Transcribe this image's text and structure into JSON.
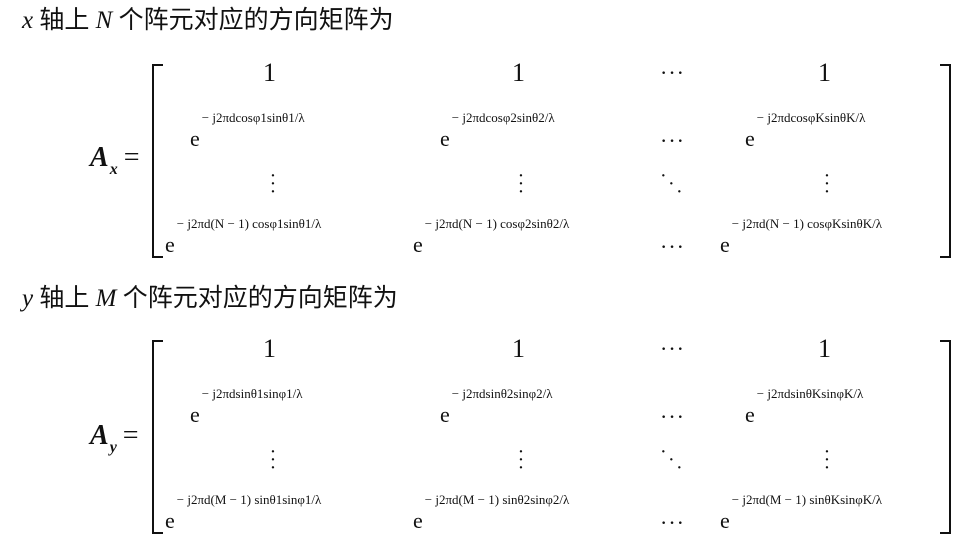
{
  "section_x": {
    "heading": {
      "axis": "x",
      "text1": " 轴上 ",
      "count": "N",
      "text2": " 个阵元对应的方向矩阵为"
    },
    "lhs": {
      "symbol": "A",
      "sub": "x",
      "eq": "="
    },
    "row1": {
      "c1": "1",
      "c2": "1",
      "c3": "···",
      "c4": "1"
    },
    "row2": {
      "base": "e",
      "c1": "− j2πdcosφ1sinθ1/λ",
      "c2": "− j2πdcosφ2sinθ2/λ",
      "c3": "···",
      "c4": "− j2πdcosφKsinθK/λ"
    },
    "row4": {
      "base": "e",
      "c1": "− j2πd(N − 1) cosφ1sinθ1/λ",
      "c2": "− j2πd(N − 1) cosφ2sinθ2/λ",
      "c3": "···",
      "c4": "− j2πd(N − 1) cosφKsinθK/λ"
    }
  },
  "section_y": {
    "heading": {
      "axis": "y",
      "text1": " 轴上 ",
      "count": "M",
      "text2": " 个阵元对应的方向矩阵为"
    },
    "lhs": {
      "symbol": "A",
      "sub": "y",
      "eq": "="
    },
    "row1": {
      "c1": "1",
      "c2": "1",
      "c3": "···",
      "c4": "1"
    },
    "row2": {
      "base": "e",
      "c1": "− j2πdsinθ1sinφ1/λ",
      "c2": "− j2πdsinθ2sinφ2/λ",
      "c3": "···",
      "c4": "− j2πdsinθKsinφK/λ"
    },
    "row4": {
      "base": "e",
      "c1": "− j2πd(M − 1) sinθ1sinφ1/λ",
      "c2": "− j2πd(M − 1) sinθ2sinφ2/λ",
      "c3": "···",
      "c4": "− j2πd(M − 1) sinθKsinφK/λ"
    }
  }
}
